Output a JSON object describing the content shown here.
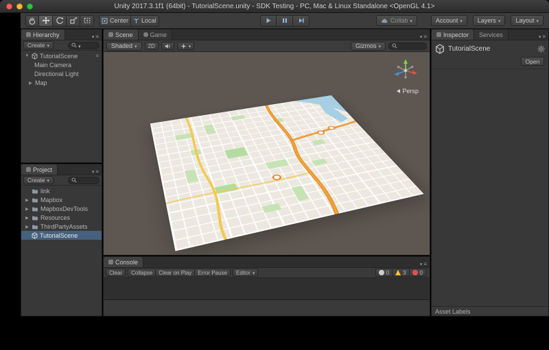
{
  "titlebar": {
    "title": "Unity 2017.3.1f1 (64bit) - TutorialScene.unity - SDK Testing - PC, Mac & Linux Standalone <OpenGL 4.1>"
  },
  "toolbar": {
    "pivot": "Center",
    "space": "Local",
    "collab": "Collab",
    "account": "Account",
    "layers": "Layers",
    "layout": "Layout"
  },
  "hierarchy": {
    "tab": "Hierarchy",
    "create": "Create",
    "scene_name": "TutorialScene",
    "items": [
      "Main Camera",
      "Directional Light",
      "Map"
    ]
  },
  "project": {
    "tab": "Project",
    "create": "Create",
    "items": [
      "link",
      "Mapbox",
      "MapboxDevTools",
      "Resources",
      "ThirdPartyAssets",
      "TutorialScene"
    ]
  },
  "scene_view": {
    "tab_scene": "Scene",
    "tab_game": "Game",
    "shaded": "Shaded",
    "mode_2d": "2D",
    "gizmos": "Gizmos",
    "persp": "Persp"
  },
  "console": {
    "tab": "Console",
    "buttons": {
      "clear": "Clear",
      "collapse": "Collapse",
      "clear_on_play": "Clear on Play",
      "error_pause": "Error Pause",
      "editor": "Editor"
    },
    "counts": {
      "info": "0",
      "warning": "3",
      "error": "0"
    }
  },
  "inspector": {
    "tab": "Inspector",
    "tab_services": "Services",
    "asset_name": "TutorialScene",
    "open": "Open",
    "footer": "Asset Labels"
  },
  "colors": {
    "selection": "#46607e",
    "scene_background": "#5e5751",
    "highway_orange": "#f5a338",
    "road_yellow": "#f2c94c",
    "park_green": "#c7e3b5",
    "water_blue": "#a6cfe3"
  }
}
